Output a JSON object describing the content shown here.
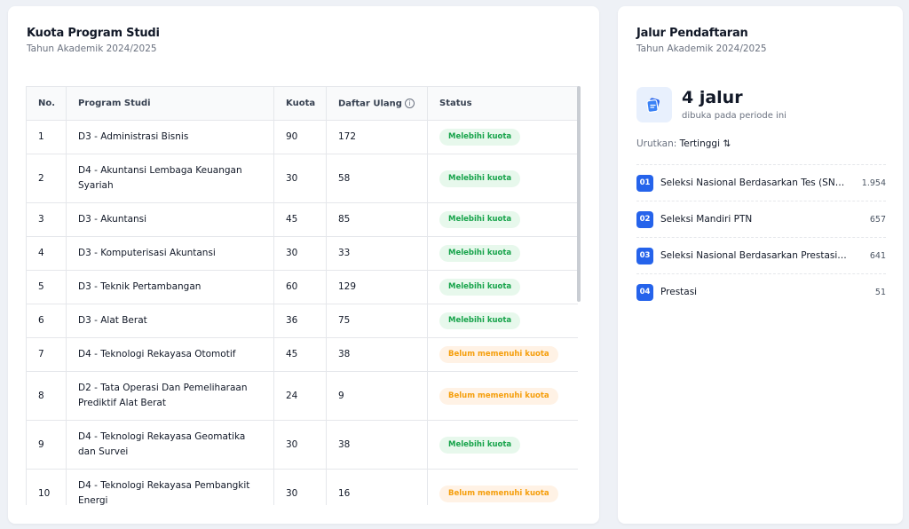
{
  "quota_card": {
    "title": "Kuota Program Studi",
    "subtitle": "Tahun Akademik 2024/2025",
    "columns": {
      "no": "No.",
      "program": "Program Studi",
      "quota": "Kuota",
      "reregister": "Daftar Ulang",
      "status": "Status"
    },
    "status_colors": {
      "over": {
        "bg": "#e7f8ec",
        "fg": "#16a34a"
      },
      "under": {
        "bg": "#fff2e5",
        "fg": "#f59e0b"
      }
    },
    "rows": [
      {
        "no": "1",
        "program": "D3 - Administrasi Bisnis",
        "quota": "90",
        "reregister": "172",
        "status": "Melebihi kuota",
        "status_type": "over",
        "tall": false
      },
      {
        "no": "2",
        "program": "D4 - Akuntansi Lembaga Keuangan Syariah",
        "quota": "30",
        "reregister": "58",
        "status": "Melebihi kuota",
        "status_type": "over",
        "tall": true
      },
      {
        "no": "3",
        "program": "D3 - Akuntansi",
        "quota": "45",
        "reregister": "85",
        "status": "Melebihi kuota",
        "status_type": "over",
        "tall": false
      },
      {
        "no": "4",
        "program": "D3 - Komputerisasi Akuntansi",
        "quota": "30",
        "reregister": "33",
        "status": "Melebihi kuota",
        "status_type": "over",
        "tall": false
      },
      {
        "no": "5",
        "program": "D3 - Teknik Pertambangan",
        "quota": "60",
        "reregister": "129",
        "status": "Melebihi kuota",
        "status_type": "over",
        "tall": false
      },
      {
        "no": "6",
        "program": "D3 - Alat Berat",
        "quota": "36",
        "reregister": "75",
        "status": "Melebihi kuota",
        "status_type": "over",
        "tall": false
      },
      {
        "no": "7",
        "program": "D4 - Teknologi Rekayasa Otomotif",
        "quota": "45",
        "reregister": "38",
        "status": "Belum memenuhi kuota",
        "status_type": "under",
        "tall": false
      },
      {
        "no": "8",
        "program": "D2 - Tata Operasi Dan Pemeliharaan Prediktif Alat Berat",
        "quota": "24",
        "reregister": "9",
        "status": "Belum memenuhi kuota",
        "status_type": "under",
        "tall": true
      },
      {
        "no": "9",
        "program": "D4 - Teknologi Rekayasa Geomatika dan Survei",
        "quota": "30",
        "reregister": "38",
        "status": "Melebihi kuota",
        "status_type": "over",
        "tall": true
      },
      {
        "no": "10",
        "program": "D4 - Teknologi Rekayasa Pembangkit Energi",
        "quota": "30",
        "reregister": "16",
        "status": "Belum memenuhi kuota",
        "status_type": "under",
        "tall": true
      }
    ]
  },
  "routes_card": {
    "title": "Jalur Pendaftaran",
    "subtitle": "Tahun Akademik 2024/2025",
    "icon": "ticket-icon",
    "stat_value": "4 jalur",
    "stat_caption": "dibuka pada periode ini",
    "sort_label": "Urutkan:",
    "sort_value": "Tertinggi",
    "sort_icon": "sort-arrows-icon",
    "accent": "#2563eb",
    "routes": [
      {
        "num": "01",
        "name": "Seleksi Nasional Berdasarkan Tes (SNBT)",
        "count": "1.954"
      },
      {
        "num": "02",
        "name": "Seleksi Mandiri PTN",
        "count": "657"
      },
      {
        "num": "03",
        "name": "Seleksi Nasional Berdasarkan Prestasi (SNBP)",
        "count": "641"
      },
      {
        "num": "04",
        "name": "Prestasi",
        "count": "51"
      }
    ]
  }
}
